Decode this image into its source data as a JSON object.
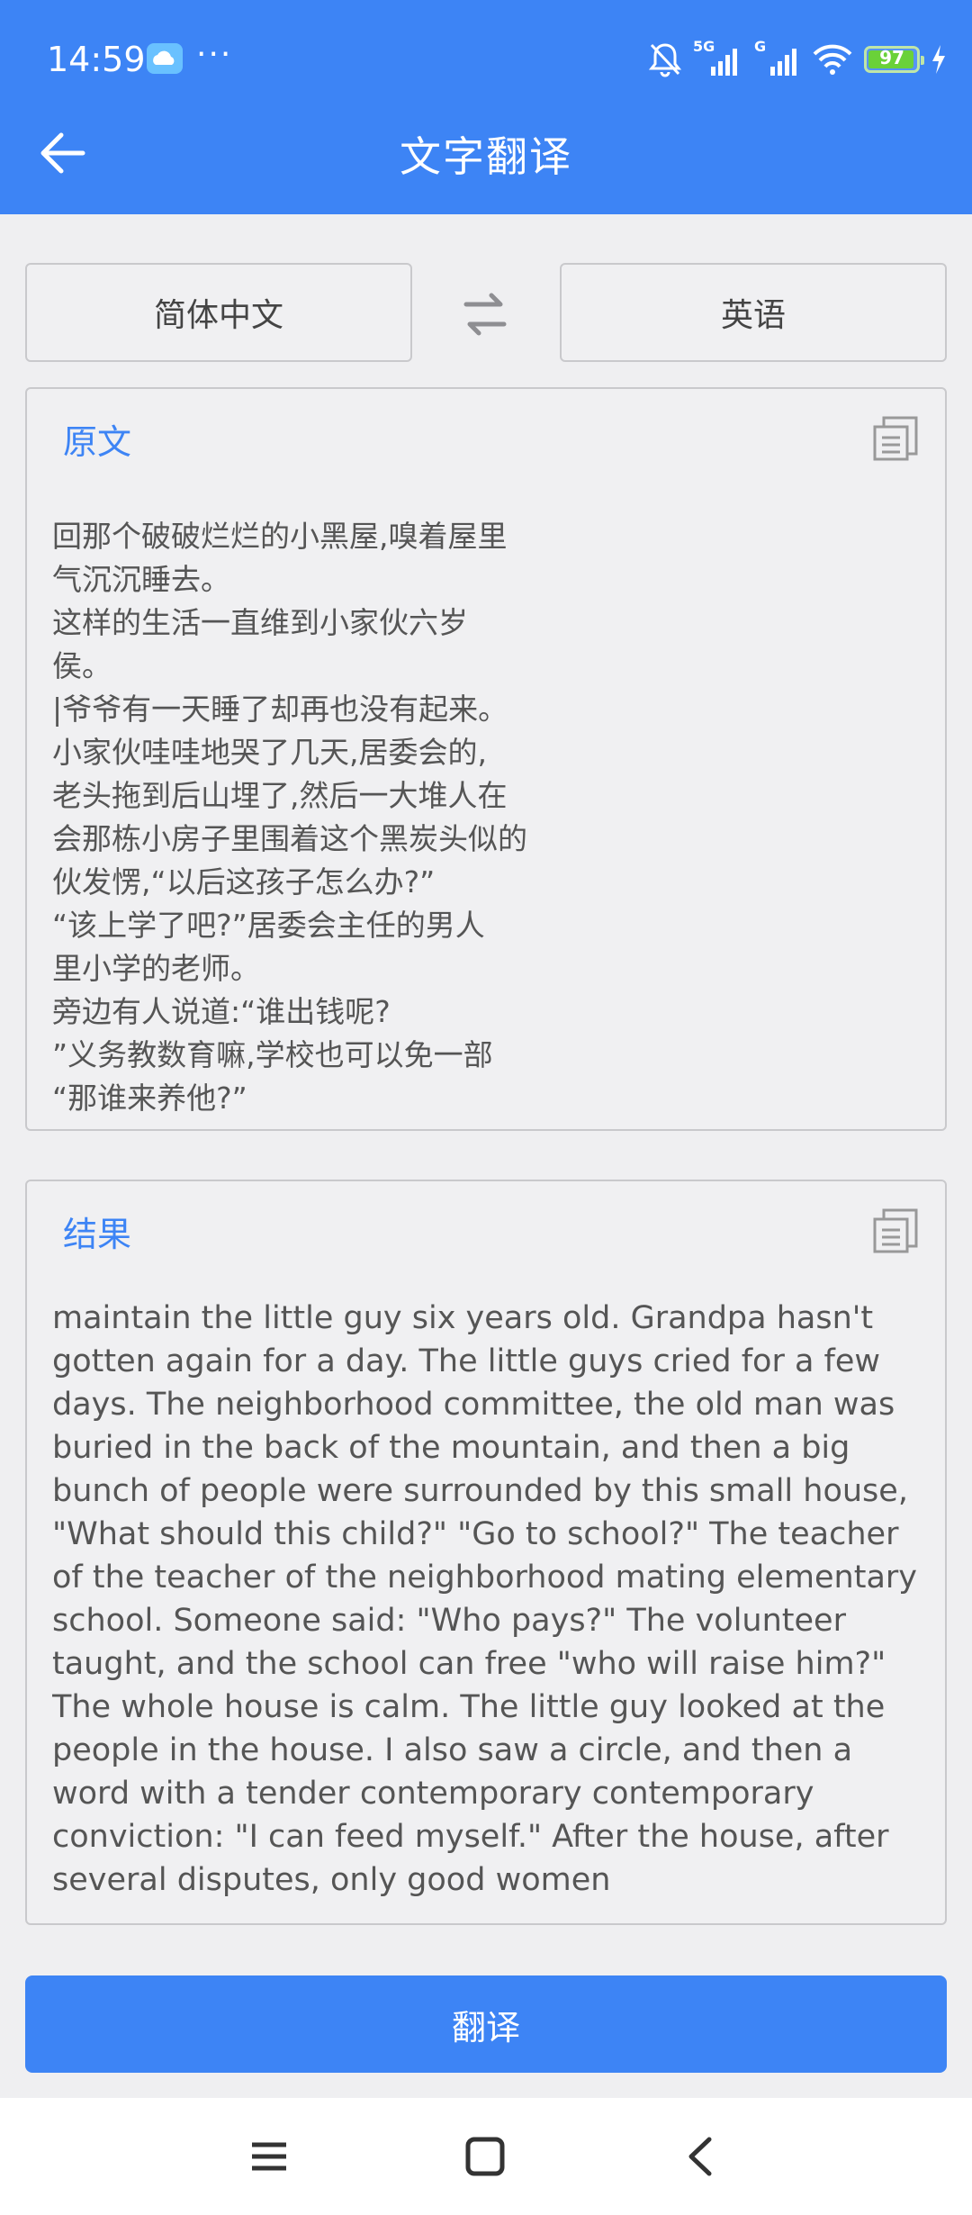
{
  "status_bar": {
    "time": "14:59",
    "more": "···",
    "network_1": "5G",
    "network_2": "G",
    "battery": "97",
    "icons": [
      "cloud-icon",
      "mute-bell-icon",
      "signal-icon",
      "wifi-icon",
      "battery-icon",
      "charging-icon"
    ]
  },
  "appbar": {
    "title": "文字翻译",
    "back_icon": "back-arrow-icon"
  },
  "languages": {
    "source": "简体中文",
    "target": "英语",
    "swap_icon": "swap-icon"
  },
  "source_panel": {
    "label": "原文",
    "copy_icon": "copy-icon",
    "text": "回那个破破烂烂的小黑屋,嗅着屋里\n气沉沉睡去。\n这样的生活一直维到小家伙六岁\n侯。\n|爷爷有一天睡了却再也没有起来。\n小家伙哇哇地哭了几天,居委会的,\n老头拖到后山埋了,然后一大堆人在\n会那栋小房子里围着这个黑炭头似的\n伙发愣,“以后这孩子怎么办?”\n“该上学了吧?”居委会主任的男人\n里小学的老师。\n旁边有人说道:“谁出钱呢?\n”义务教数育嘛,学校也可以免一部\n“那谁来养他?”"
  },
  "result_panel": {
    "label": "结果",
    "copy_icon": "copy-icon",
    "text": "maintain the little guy six years old. Grandpa hasn't gotten again for a day. The little guys cried for a few days. The neighborhood committee, the old man was buried in the back of the mountain, and then a big bunch of people were surrounded by this small house, \"What should this child?\" \"Go to school?\" The teacher of the teacher of the neighborhood mating elementary school. Someone said: \"Who pays?\" The volunteer taught, and the school can free \"who will raise him?\" The whole house is calm. The little guy looked at the people in the house. I also saw a circle, and then a word with a tender contemporary contemporary conviction: \"I can feed myself.\" After the house, after several disputes, only good women"
  },
  "translate_button": {
    "label": "翻译"
  },
  "nav_bar": {
    "icons": [
      "menu-icon",
      "home-icon",
      "back-icon"
    ]
  },
  "colors": {
    "accent": "#3d84f5",
    "background": "#efeff1",
    "text": "#555555"
  }
}
